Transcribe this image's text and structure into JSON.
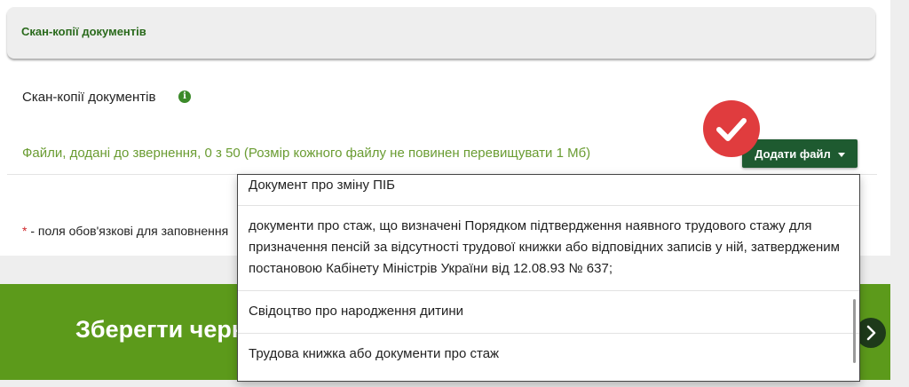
{
  "section": {
    "title": "Скан-копії документів"
  },
  "field": {
    "label": "Скан-копії документів",
    "info_icon": "info-circle-icon"
  },
  "files": {
    "info": "Файли, додані до звернення, 0 з 50 (Розмір кожного файлу не повинен перевищувати 1 Мб)",
    "add_button": "Додати файл"
  },
  "required_note": {
    "star": "*",
    "text": " - поля обов'язкові для заповнення"
  },
  "save": {
    "label": "Зберегти чернетку"
  },
  "dropdown": {
    "items": [
      "Документ про зміну ПІБ",
      "документи про стаж, що визначені Порядком підтвердження наявного трудового стажу для призначення пенсій за відсутності трудової книжки або відповідних записів у ній, затвердженим постановою Кабінету Міністрів України від 12.08.93 № 637;",
      "Свідоцтво про народження дитини",
      "Трудова книжка або документи про стаж"
    ]
  },
  "colors": {
    "accent_green": "#5c9a1b",
    "button_dark_green": "#1e5a30",
    "badge_red": "#e03c3e",
    "required_red": "#d0262b"
  }
}
